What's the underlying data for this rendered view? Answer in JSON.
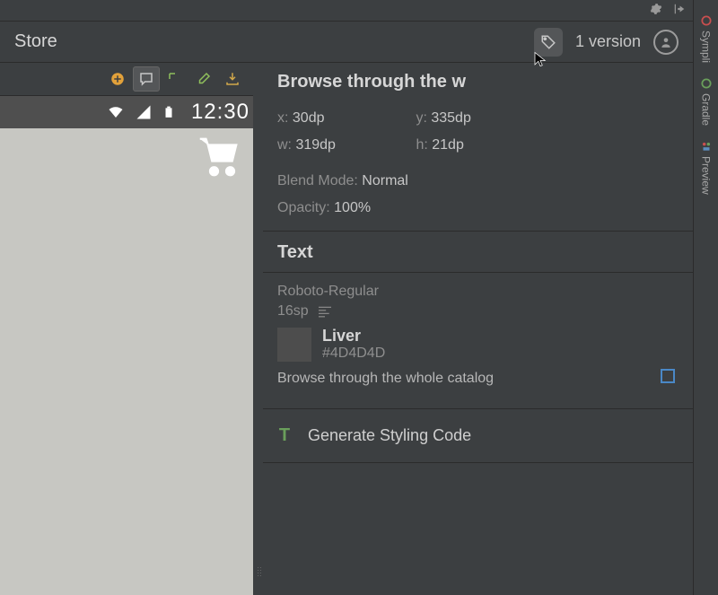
{
  "top": {
    "gear_icon": "gear",
    "hide_icon": "hide"
  },
  "header": {
    "title": "Store",
    "version_label": "1 version"
  },
  "canvas": {
    "status_time": "12:30"
  },
  "inspector": {
    "title": "Browse through the w",
    "x_label": "x:",
    "x_value": "30dp",
    "y_label": "y:",
    "y_value": "335dp",
    "w_label": "w:",
    "w_value": "319dp",
    "h_label": "h:",
    "h_value": "21dp",
    "blend_label": "Blend Mode:",
    "blend_value": "Normal",
    "opacity_label": "Opacity:",
    "opacity_value": "100%",
    "text_section": "Text",
    "font_family": "Roboto-Regular",
    "font_size": "16sp",
    "color_name": "Liver",
    "color_hex": "#4D4D4D",
    "sample": "Browse through the whole catalog",
    "generate_label": "Generate Styling Code"
  },
  "rail": {
    "sympli": "Sympli",
    "gradle": "Gradle",
    "preview": "Preview"
  }
}
